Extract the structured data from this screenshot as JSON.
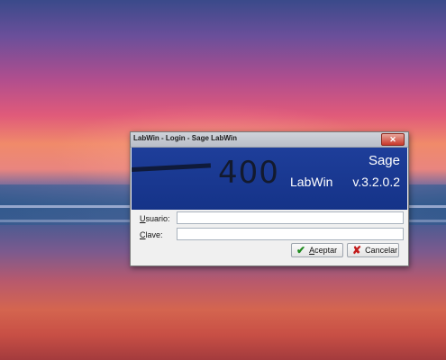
{
  "window": {
    "title": "LabWin - Login - Sage LabWin",
    "close_symbol": "✕"
  },
  "banner": {
    "number": "400",
    "brand": "Sage",
    "product": "LabWin",
    "version": "v.3.2.0.2"
  },
  "form": {
    "usuario_label_mnemonic": "U",
    "usuario_label_rest": "suario:",
    "usuario_value": "",
    "clave_label_mnemonic": "C",
    "clave_label_rest": "lave:",
    "clave_value": ""
  },
  "buttons": {
    "accept_mnemonic": "A",
    "accept_rest": "ceptar",
    "accept_icon": "check-icon",
    "cancel_label": "Cancelar",
    "cancel_icon": "x-icon"
  },
  "colors": {
    "banner_blue": "#1e3e9a",
    "accept_green": "#1f8a1f",
    "cancel_red": "#c21b1b"
  }
}
